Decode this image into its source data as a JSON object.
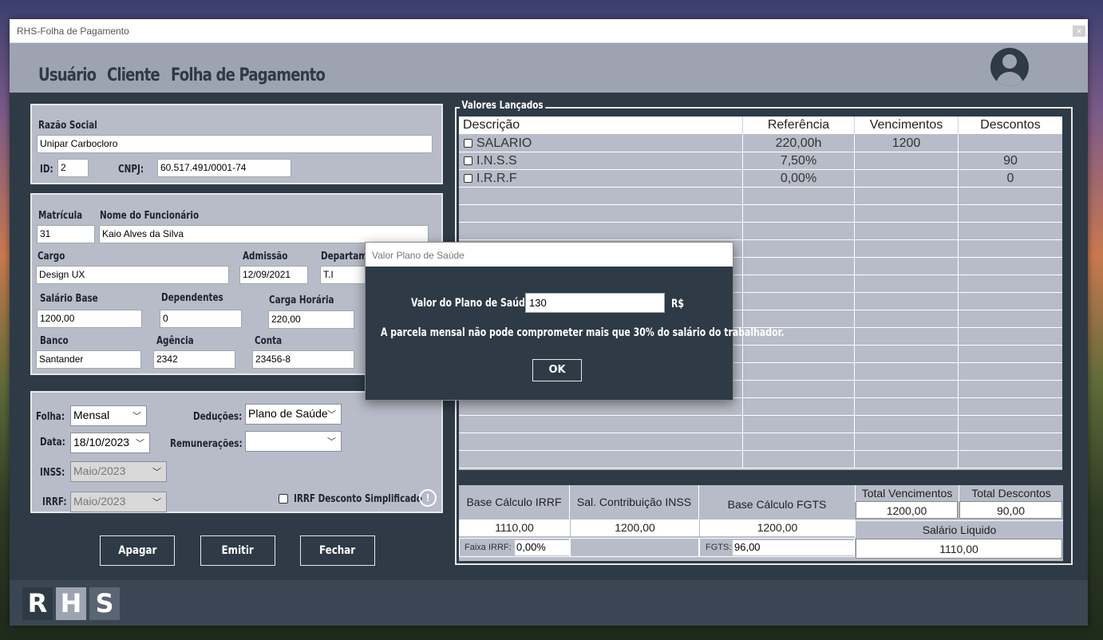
{
  "window": {
    "title": "RHS-Folha de Pagamento",
    "close": "✕"
  },
  "menu": {
    "items": [
      "Usuário",
      "Cliente",
      "Folha de Pagamento"
    ]
  },
  "empresa": {
    "razao_label": "Razão Social",
    "razao_value": "Unipar Carbocloro",
    "id_label": "ID:",
    "id_value": "2",
    "cnpj_label": "CNPJ:",
    "cnpj_value": "60.517.491/0001-74"
  },
  "funcionario": {
    "matricula_label": "Matrícula",
    "matricula_value": "31",
    "nome_label": "Nome do Funcionário",
    "nome_value": "Kaio Alves da Silva",
    "cargo_label": "Cargo",
    "cargo_value": "Design UX",
    "admissao_label": "Admissão",
    "admissao_value": "12/09/2021",
    "depto_label": "Departam",
    "depto_value": "T.I",
    "salario_label": "Salário Base",
    "salario_value": "1200,00",
    "dependentes_label": "Dependentes",
    "dependentes_value": "0",
    "carga_label": "Carga Horária",
    "carga_value": "220,00",
    "banco_label": "Banco",
    "banco_value": "Santander",
    "agencia_label": "Agência",
    "agencia_value": "2342",
    "conta_label": "Conta",
    "conta_value": "23456-8"
  },
  "folha": {
    "folha_label": "Folha:",
    "folha_value": "Mensal",
    "deducoes_label": "Deduções:",
    "deducoes_value": "Plano de Saúde",
    "data_label": "Data:",
    "data_value": "18/10/2023",
    "remun_label": "Remunerações:",
    "remun_value": "",
    "inss_label": "INSS:",
    "inss_value": "Maio/2023",
    "irrf_label": "IRRF:",
    "irrf_value": "Maio/2023",
    "simplificado_label": "IRRF Desconto Simplificado"
  },
  "buttons": {
    "apagar": "Apagar",
    "emitir": "Emitir",
    "fechar": "Fechar"
  },
  "valores": {
    "legend": "Valores Lançados",
    "headers": [
      "Descrição",
      "Referência",
      "Vencimentos",
      "Descontos"
    ],
    "rows": [
      [
        "SALARIO",
        "220,00h",
        "1200",
        ""
      ],
      [
        "I.N.S.S",
        "7,50%",
        "",
        "90"
      ],
      [
        "I.R.R.F",
        "0,00%",
        "",
        "0"
      ]
    ]
  },
  "totais": {
    "base_irrf_label": "Base Cálculo IRRF",
    "base_irrf_value": "1110,00",
    "sal_inss_label": "Sal. Contribuição INSS",
    "sal_inss_value": "1200,00",
    "base_fgts_label": "Base Cálculo FGTS",
    "base_fgts_value": "1200,00",
    "total_venc_label": "Total Vencimentos",
    "total_venc_value": "1200,00",
    "total_desc_label": "Total Descontos",
    "total_desc_value": "90,00",
    "liquido_label": "Salário Liquido",
    "liquido_value": "1110,00",
    "faixa_label": "Faixa IRRF:",
    "faixa_value": "0,00%",
    "fgts_label": "FGTS:",
    "fgts_value": "96,00"
  },
  "dialog": {
    "title": "Valor Plano de Saúde",
    "field_label": "Valor do Plano de Saúde:",
    "field_value": "130",
    "currency": "R$",
    "message": "A parcela mensal não pode comprometer mais que 30% do salário do trabalhador.",
    "ok": "OK"
  },
  "logo": [
    "R",
    "H",
    "S"
  ]
}
